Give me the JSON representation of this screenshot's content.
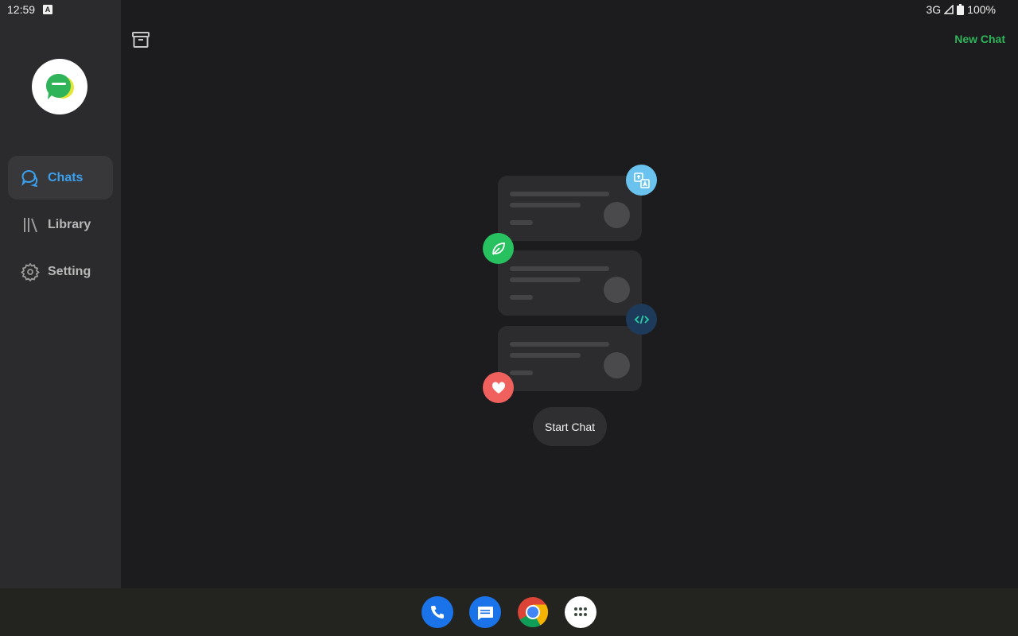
{
  "status_bar": {
    "time": "12:59",
    "network": "3G",
    "battery": "100%"
  },
  "sidebar": {
    "items": [
      {
        "label": "Chats",
        "icon": "chat-bubble-icon",
        "active": true
      },
      {
        "label": "Library",
        "icon": "library-icon",
        "active": false
      },
      {
        "label": "Setting",
        "icon": "gear-icon",
        "active": false
      }
    ]
  },
  "header": {
    "new_chat_label": "New Chat"
  },
  "empty_state": {
    "start_chat_label": "Start Chat"
  },
  "colors": {
    "accent_blue": "#3aa0f0",
    "accent_green": "#2fb45a",
    "background": "#1c1c1e",
    "sidebar": "#2b2b2d"
  },
  "taskbar": {
    "apps": [
      "phone-icon",
      "messages-icon",
      "chrome-icon",
      "app-drawer-icon"
    ]
  }
}
